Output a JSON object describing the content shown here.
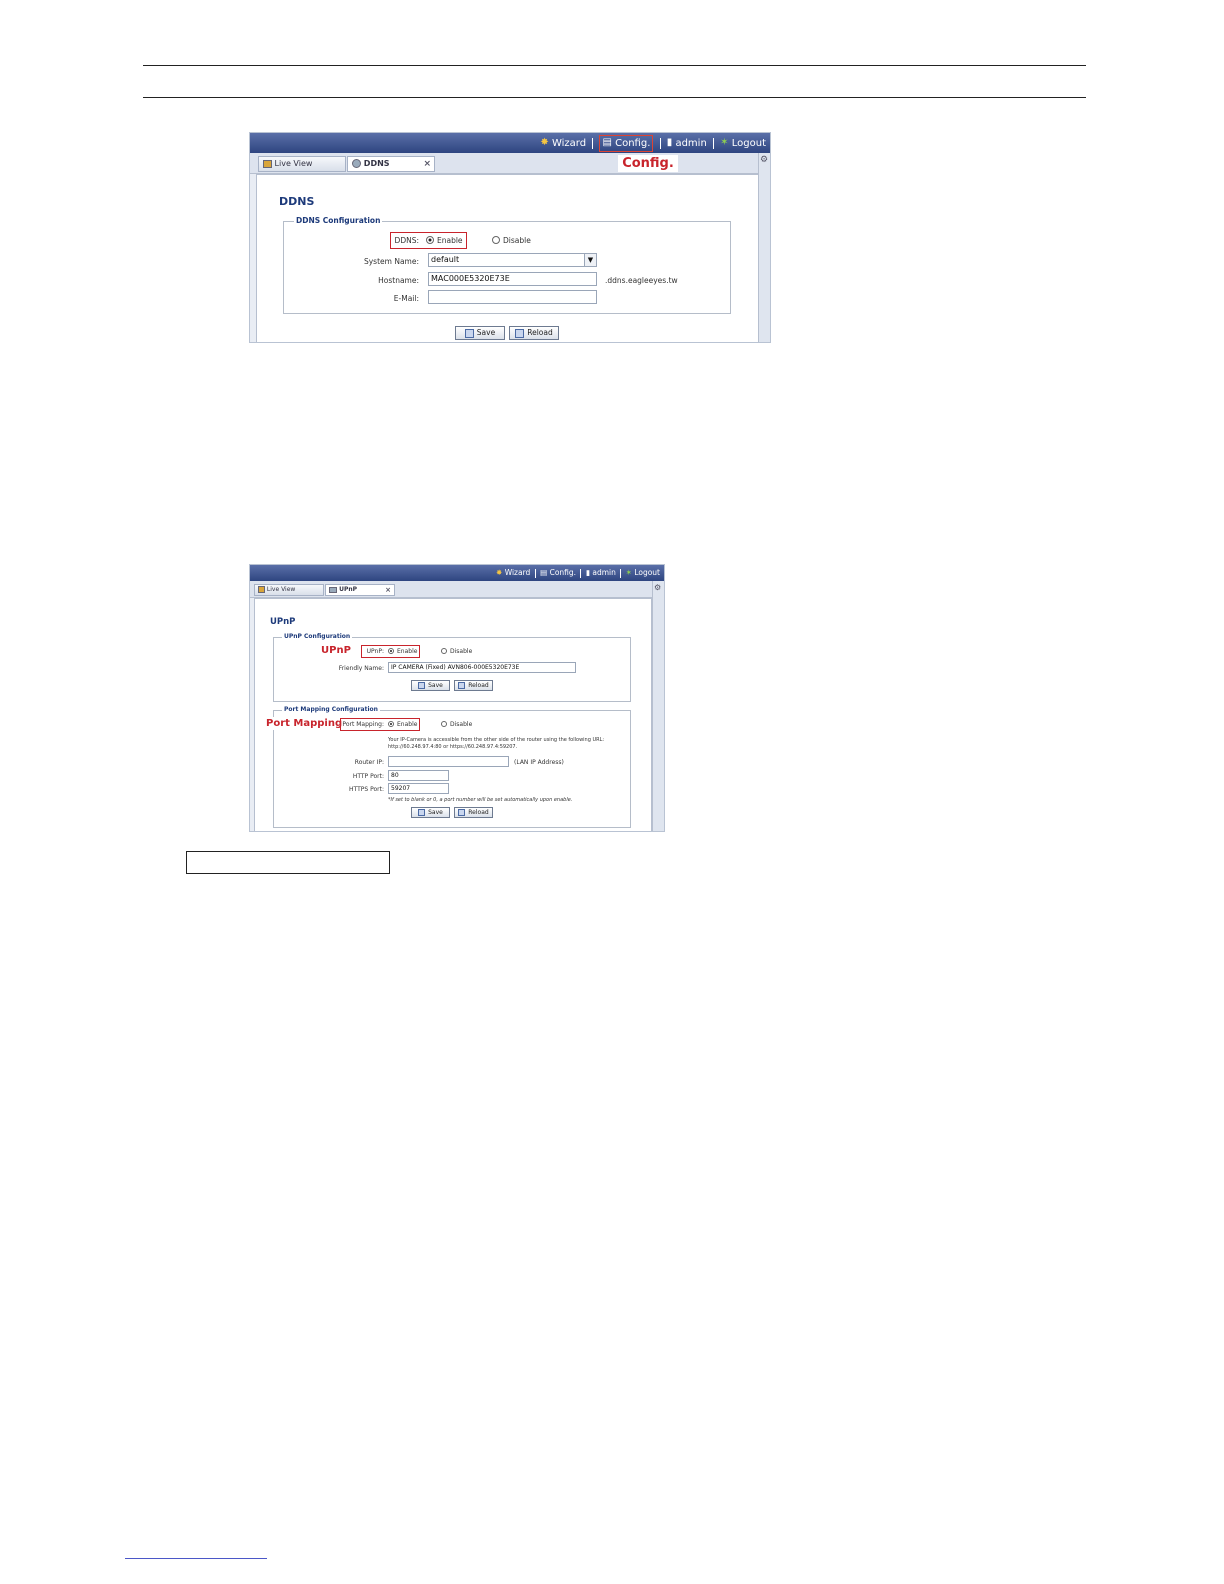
{
  "topbar": {
    "wizard": "Wizard",
    "config": "Config.",
    "admin": "admin",
    "logout": "Logout"
  },
  "ddns_screen": {
    "tabs": [
      {
        "label": "Live View"
      },
      {
        "label": "DDNS"
      }
    ],
    "tab_close": "×",
    "callout": "Config.",
    "heading": "DDNS",
    "fieldset_legend": "DDNS Configuration",
    "ddns_label": "DDNS:",
    "enable_label": "Enable",
    "disable_label": "Disable",
    "ddns_state": "Enable",
    "system_name_label": "System Name:",
    "system_name_value": "default",
    "hostname_label": "Hostname:",
    "hostname_value": "MAC000E5320E73E",
    "hostname_suffix": ".ddns.eagleeyes.tw",
    "email_label": "E-Mail:",
    "email_value": "",
    "save_label": "Save",
    "reload_label": "Reload"
  },
  "upnp_screen": {
    "tabs": [
      {
        "label": "Live View"
      },
      {
        "label": "UPnP"
      }
    ],
    "tab_close": "×",
    "heading": "UPnP",
    "upnp_legend": "UPnP Configuration",
    "upnp_callout": "UPnP",
    "upnp_label": "UPnP:",
    "enable_label": "Enable",
    "disable_label": "Disable",
    "upnp_state": "Enable",
    "friendly_name_label": "Friendly Name:",
    "friendly_name_value": "IP CAMERA (Fixed) AVN806-000E5320E73E",
    "save_label": "Save",
    "reload_label": "Reload",
    "port_legend": "Port Mapping Configuration",
    "port_callout": "Port Mapping",
    "port_label": "Port Mapping:",
    "port_state": "Enable",
    "info_line1": "Your IP-Camera is accessible from the other side of the router using the following URL:",
    "info_line2": "http://60.248.97.4:80 or https://60.248.97.4:59207.",
    "router_ip_label": "Router IP:",
    "router_ip_value": "",
    "router_ip_hint": "(LAN IP Address)",
    "http_port_label": "HTTP Port:",
    "http_port_value": "80",
    "https_port_label": "HTTPS Port:",
    "https_port_value": "59207",
    "port_note": "*If set to blank or 0, a port number will be set automatically upon enable."
  },
  "colors": {
    "callout_red": "#c8242c",
    "heading_blue": "#1d3a7a",
    "topbar_blue": "#2e4580"
  }
}
